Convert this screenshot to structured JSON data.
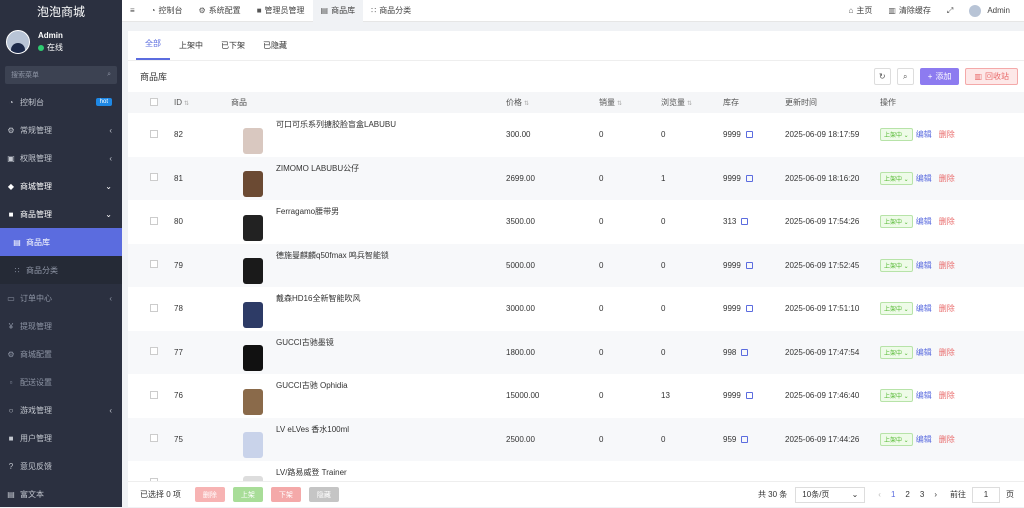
{
  "app": {
    "title": "泡泡商城"
  },
  "user": {
    "name": "Admin",
    "status": "在线"
  },
  "sidebar": {
    "search_placeholder": "搜索菜单",
    "items": [
      {
        "label": "控制台",
        "icon": "dashboard-icon",
        "badge": "hot"
      },
      {
        "label": "常规管理",
        "icon": "gears-icon"
      },
      {
        "label": "权限管理",
        "icon": "group-icon"
      },
      {
        "label": "商城管理",
        "icon": "shop-icon"
      },
      {
        "label": "商品管理",
        "icon": "box-icon"
      },
      {
        "label": "商品库",
        "icon": "bag-icon"
      },
      {
        "label": "商品分类",
        "icon": "sitemap-icon"
      },
      {
        "label": "订单中心",
        "icon": "file-icon"
      },
      {
        "label": "提现管理",
        "icon": "yen-icon"
      },
      {
        "label": "商城配置",
        "icon": "cog-icon"
      },
      {
        "label": "配送设置",
        "icon": "truck-icon"
      },
      {
        "label": "游戏管理",
        "icon": "gamepad-icon"
      },
      {
        "label": "用户管理",
        "icon": "user-icon"
      },
      {
        "label": "意见反馈",
        "icon": "question-icon"
      },
      {
        "label": "富文本",
        "icon": "text-icon"
      }
    ]
  },
  "topbar": {
    "tabs": [
      {
        "label": "控制台",
        "icon": "dashboard-icon"
      },
      {
        "label": "系统配置",
        "icon": "cog-icon"
      },
      {
        "label": "管理员管理",
        "icon": "user-icon"
      },
      {
        "label": "商品库",
        "icon": "bag-icon"
      },
      {
        "label": "商品分类",
        "icon": "sitemap-icon"
      }
    ],
    "home": "主页",
    "clear_cache": "清除缓存",
    "admin": "Admin"
  },
  "filter_tabs": [
    "全部",
    "上架中",
    "已下架",
    "已隐藏"
  ],
  "toolbar": {
    "title": "商品库",
    "add": "添加",
    "recycle": "回收站"
  },
  "table": {
    "headers": {
      "id": "ID",
      "product": "商品",
      "price": "价格",
      "sales": "销量",
      "views": "浏览量",
      "stock": "库存",
      "updated": "更新时间",
      "actions": "操作"
    },
    "edit_label": "编辑",
    "delete_label": "删除",
    "status_label": "上架中",
    "rows": [
      {
        "id": "82",
        "name": "可口可乐系列搪胶脸盲盒LABUBU",
        "price": "300.00",
        "sales": "0",
        "views": "0",
        "stock": "9999",
        "updated": "2025-06-09 18:17:59",
        "thumb_color": "#d9c8c0"
      },
      {
        "id": "81",
        "name": "ZIMOMO LABUBU公仔",
        "price": "2699.00",
        "sales": "0",
        "views": "1",
        "stock": "9999",
        "updated": "2025-06-09 18:16:20",
        "thumb_color": "#6b4a33"
      },
      {
        "id": "80",
        "name": "Ferragamo腰带男",
        "price": "3500.00",
        "sales": "0",
        "views": "0",
        "stock": "313",
        "updated": "2025-06-09 17:54:26",
        "thumb_color": "#222222"
      },
      {
        "id": "79",
        "name": "德施曼麒麟q50fmax 鸣兵智能锁",
        "price": "5000.00",
        "sales": "0",
        "views": "0",
        "stock": "9999",
        "updated": "2025-06-09 17:52:45",
        "thumb_color": "#1a1a1a"
      },
      {
        "id": "78",
        "name": "戴森HD16全新智能吹风",
        "price": "3000.00",
        "sales": "0",
        "views": "0",
        "stock": "9999",
        "updated": "2025-06-09 17:51:10",
        "thumb_color": "#2d3b66"
      },
      {
        "id": "77",
        "name": "GUCCI古驰墨镜",
        "price": "1800.00",
        "sales": "0",
        "views": "0",
        "stock": "998",
        "updated": "2025-06-09 17:47:54",
        "thumb_color": "#111111"
      },
      {
        "id": "76",
        "name": "GUCCI古驰 Ophidia",
        "price": "15000.00",
        "sales": "0",
        "views": "13",
        "stock": "9999",
        "updated": "2025-06-09 17:46:40",
        "thumb_color": "#8a6a4a"
      },
      {
        "id": "75",
        "name": "LV eLVes 香水100ml",
        "price": "2500.00",
        "sales": "0",
        "views": "0",
        "stock": "959",
        "updated": "2025-06-09 17:44:26",
        "thumb_color": "#c9d3ea"
      },
      {
        "id": "",
        "name": "LV/路易威登 Trainer",
        "price": "",
        "sales": "",
        "views": "",
        "stock": "",
        "updated": "",
        "thumb_color": "#dddddd"
      }
    ]
  },
  "footer": {
    "selected": "已选择 0 项",
    "delete": "删除",
    "on_shelf": "上架",
    "off_shelf": "下架",
    "hide": "隐藏",
    "total": "共 30 条",
    "page_size": "10条/页",
    "pages": [
      "1",
      "2",
      "3"
    ],
    "goto": "前往",
    "page_value": "1",
    "page_unit": "页"
  },
  "colors": {
    "accent": "#5b6cdf",
    "sidebar": "#2b3040",
    "success": "#52b830",
    "danger": "#e96b6b"
  }
}
